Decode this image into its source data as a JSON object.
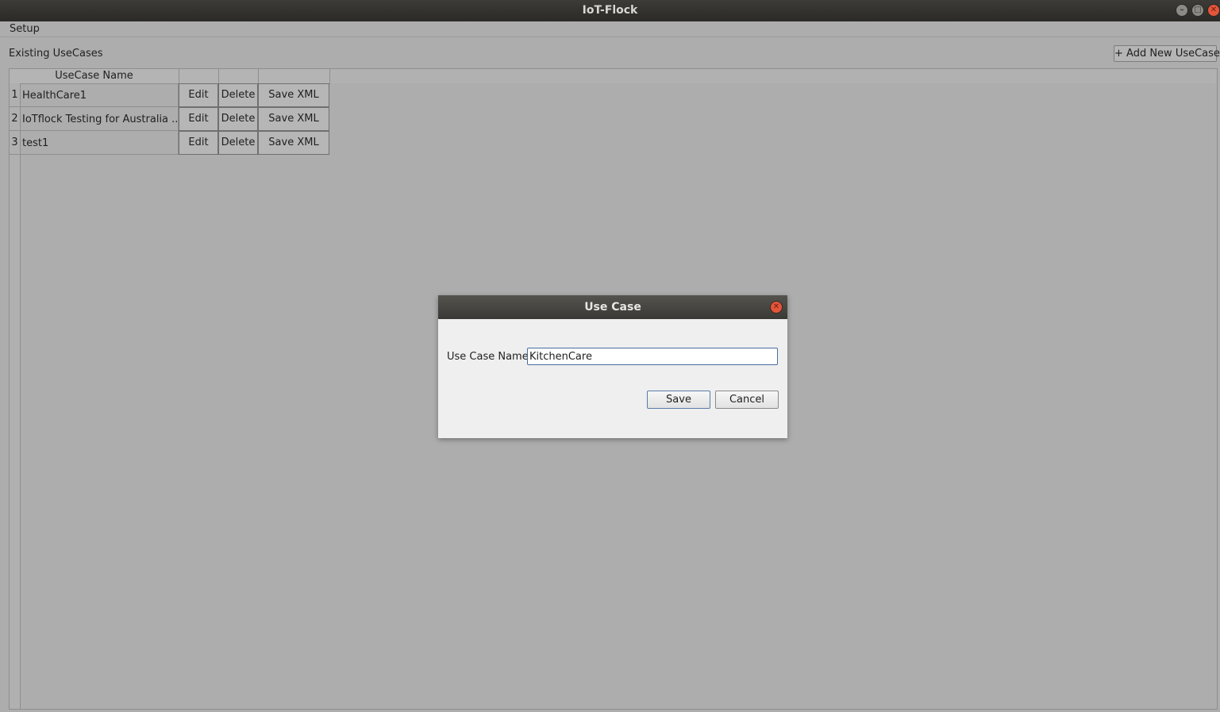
{
  "window": {
    "title": "IoT-Flock"
  },
  "menu": {
    "items": [
      {
        "label": "Setup"
      }
    ]
  },
  "main": {
    "existing_label": "Existing UseCases",
    "add_button": "+ Add New UseCase",
    "table": {
      "header": {
        "name": "UseCase Name"
      },
      "rows": [
        {
          "index": "1",
          "name": "HealthCare1",
          "edit": "Edit",
          "delete": "Delete",
          "save_xml": "Save XML"
        },
        {
          "index": "2",
          "name": "IoTflock Testing for Australia ...",
          "edit": "Edit",
          "delete": "Delete",
          "save_xml": "Save XML"
        },
        {
          "index": "3",
          "name": "test1",
          "edit": "Edit",
          "delete": "Delete",
          "save_xml": "Save XML"
        }
      ]
    }
  },
  "dialog": {
    "title": "Use Case",
    "field_label": "Use Case Name",
    "field_value": "KitchenCare",
    "save_label": "Save",
    "cancel_label": "Cancel"
  }
}
